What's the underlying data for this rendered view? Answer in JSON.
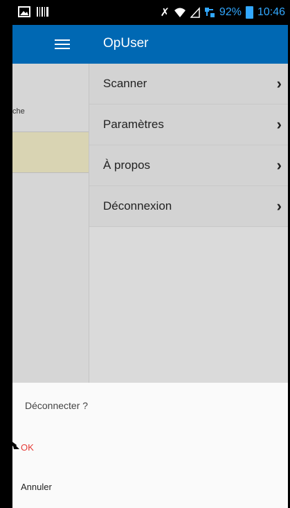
{
  "status_bar": {
    "battery": "92%",
    "time": "10:46",
    "icons": [
      "image-icon",
      "barcode-icon",
      "mute-icon",
      "wifi-icon",
      "signal-icon",
      "network-icon",
      "battery-icon"
    ]
  },
  "background_app": {
    "partial_label": "che"
  },
  "app_bar": {
    "title": "OpUser",
    "menu_icon": "hamburger-icon",
    "color": "#0068b3"
  },
  "drawer": {
    "items": [
      {
        "label": "Scanner"
      },
      {
        "label": "Paramètres"
      },
      {
        "label": "À propos"
      },
      {
        "label": "Déconnexion"
      }
    ]
  },
  "dialog": {
    "title": "Déconnecter ?",
    "ok_label": "OK",
    "cancel_label": "Annuler",
    "ok_color": "#e53935"
  }
}
